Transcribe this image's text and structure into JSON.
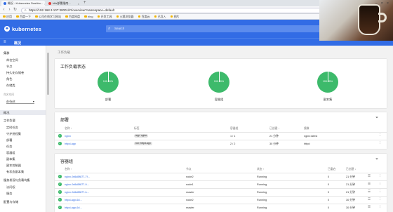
{
  "browser": {
    "tabs": [
      {
        "label": "概况 - Kubernetes Dashbo...",
        "active": true
      },
      {
        "label": "k8s部署指南...",
        "active": false
      }
    ],
    "new_tab": "+",
    "url_prefix": "不安全",
    "url": "https://192.168.3.107:30001/#!/overview?namespace=default",
    "bookmarks": [
      "应用",
      "百度一下",
      "公司在线学习网站",
      "百度网盘",
      "bing",
      "开发工具",
      "火狐浏览器",
      "百度云",
      "已导入",
      "图片"
    ]
  },
  "header": {
    "logo_glyph": "⎈",
    "brand": "kubernetes",
    "search_placeholder": "Search",
    "create_label": "+ 创建"
  },
  "subbar": {
    "menu_glyph": "≡",
    "title": "概况"
  },
  "sidebar": {
    "items": [
      {
        "label": "集群",
        "kind": "group"
      },
      {
        "label": "命名空间",
        "kind": "sub"
      },
      {
        "label": "节点",
        "kind": "sub"
      },
      {
        "label": "持久化存储卷",
        "kind": "sub"
      },
      {
        "label": "角色",
        "kind": "sub"
      },
      {
        "label": "存储类",
        "kind": "sub"
      },
      {
        "label": "命名空间",
        "kind": "hdr"
      },
      {
        "label": "概况",
        "kind": "active"
      },
      {
        "label": "工作负载",
        "kind": "group"
      },
      {
        "label": "定时任务",
        "kind": "sub"
      },
      {
        "label": "守护进程集",
        "kind": "sub"
      },
      {
        "label": "部署",
        "kind": "sub"
      },
      {
        "label": "任务",
        "kind": "sub"
      },
      {
        "label": "容器组",
        "kind": "sub"
      },
      {
        "label": "副本集",
        "kind": "sub"
      },
      {
        "label": "副本控制器",
        "kind": "sub"
      },
      {
        "label": "有状态副本集",
        "kind": "sub"
      },
      {
        "label": "服务发现与负载均衡",
        "kind": "group"
      },
      {
        "label": "访问权",
        "kind": "sub"
      },
      {
        "label": "服务",
        "kind": "sub"
      },
      {
        "label": "配置与存储",
        "kind": "group"
      }
    ],
    "namespace_value": "default"
  },
  "main": {
    "breadcrumb": "工作负载",
    "workload_status": {
      "title": "工作负载状态",
      "charts": [
        {
          "label": "部署",
          "percent_text": "100.00%",
          "value": 1.0
        },
        {
          "label": "容器组",
          "percent_text": "100.00%",
          "value": 1.0
        },
        {
          "label": "副本集",
          "percent_text": "100.00%",
          "value": 1.0
        }
      ]
    },
    "deployments": {
      "title": "部署",
      "filter_icon": "filter-icon",
      "headers": [
        "名称 ↑",
        "标签",
        "容器组",
        "已创建 ↓",
        "镜像"
      ],
      "rows": [
        {
          "name": "nginx",
          "label": "app: nginx",
          "pods": "1 / 1",
          "created": "21 分钟",
          "image": "nginx:latest"
        },
        {
          "name": "httpd-app",
          "label": "run: httpd-app",
          "pods": "2 / 2",
          "created": "30 分钟",
          "image": "httpd"
        }
      ]
    },
    "pods": {
      "title": "容器组",
      "headers": [
        "名称 ↑",
        "节点",
        "状态 ↑",
        "已重启",
        "已创建 ↓"
      ],
      "rows": [
        {
          "name": "nginx-9d6d5f877-7f...",
          "node": "node2",
          "status": "Running",
          "restarts": "0",
          "created": "21 分钟"
        },
        {
          "name": "nginx-9d6d5f877-9...",
          "node": "node1",
          "status": "Running",
          "restarts": "0",
          "created": "21 分钟"
        },
        {
          "name": "nginx-9d6d5f877-h...",
          "node": "master",
          "status": "Running",
          "restarts": "0",
          "created": "21 分钟"
        },
        {
          "name": "httpd-app-6d...",
          "node": "node2",
          "status": "Running",
          "restarts": "0",
          "created": "30 分钟"
        },
        {
          "name": "httpd-app-6d...",
          "node": "master",
          "status": "Running",
          "restarts": "0",
          "created": "30 分钟"
        }
      ]
    }
  },
  "colors": {
    "brand": "#326ce5",
    "success": "#3dba6b"
  }
}
